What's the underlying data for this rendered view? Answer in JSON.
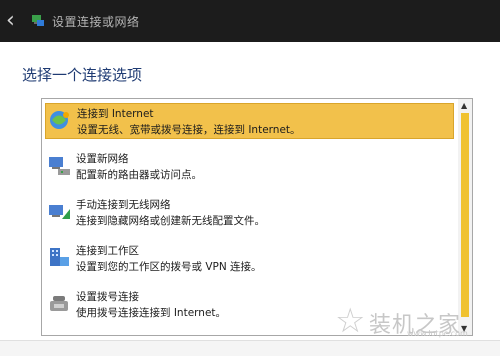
{
  "window": {
    "title": "设置连接或网络"
  },
  "dialog": {
    "heading": "选择一个连接选项"
  },
  "options": [
    {
      "title": "连接到 Internet",
      "desc": "设置无线、宽带或拨号连接，连接到 Internet。",
      "selected": true,
      "icon": "internet-globe-icon"
    },
    {
      "title": "设置新网络",
      "desc": "配置新的路由器或访问点。",
      "selected": false,
      "icon": "new-network-icon"
    },
    {
      "title": "手动连接到无线网络",
      "desc": "连接到隐藏网络或创建新无线配置文件。",
      "selected": false,
      "icon": "wireless-network-icon"
    },
    {
      "title": "连接到工作区",
      "desc": "设置到您的工作区的拨号或 VPN 连接。",
      "selected": false,
      "icon": "workplace-icon"
    },
    {
      "title": "设置拨号连接",
      "desc": "使用拨号连接连接到 Internet。",
      "selected": false,
      "icon": "dialup-phone-icon"
    }
  ],
  "watermark": {
    "text": "装机之家",
    "url": "www.lotpc.com"
  },
  "colors": {
    "selection": "#f2c14b",
    "scroll_thumb": "#f0c230",
    "heading": "#1f3b73"
  }
}
